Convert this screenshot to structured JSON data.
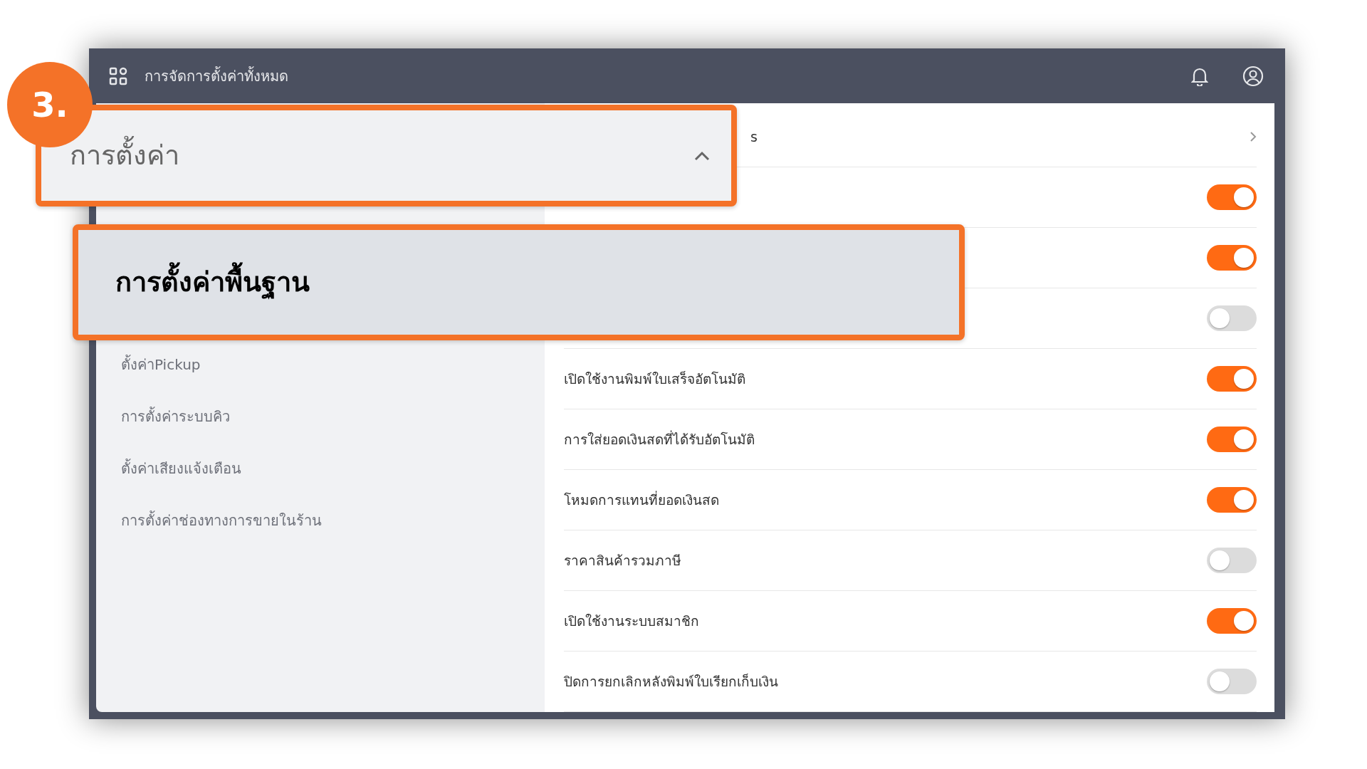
{
  "header": {
    "title": "การจัดการตั้งค่าทั้งหมด"
  },
  "sidebar": {
    "items": [
      {
        "label": "ตั้งค่าPickup"
      },
      {
        "label": "การตั้งค่าระบบคิว"
      },
      {
        "label": "ตั้งค่าเสียงแจ้งเตือน"
      },
      {
        "label": "การตั้งค่าช่องทางการขายในร้าน"
      }
    ]
  },
  "settings": [
    {
      "kind": "link",
      "label": "s"
    },
    {
      "kind": "toggle",
      "on": true
    },
    {
      "kind": "toggle",
      "on": true
    },
    {
      "kind": "toggle",
      "on": false
    },
    {
      "kind": "toggle",
      "label": "เปิดใช้งานพิมพ์ใบเสร็จอัตโนมัติ",
      "on": true
    },
    {
      "kind": "toggle",
      "label": "การใส่ยอดเงินสดที่ได้รับอัตโนมัติ",
      "on": true
    },
    {
      "kind": "toggle",
      "label": "โหมดการแทนที่ยอดเงินสด",
      "on": true
    },
    {
      "kind": "toggle",
      "label": "ราคาสินค้ารวมภาษี",
      "on": false
    },
    {
      "kind": "toggle",
      "label": "เปิดใช้งานระบบสมาชิก",
      "on": true
    },
    {
      "kind": "toggle",
      "label": "ปิดการยกเลิกหลังพิมพ์ใบเรียกเก็บเงิน",
      "on": false
    }
  ],
  "callout": {
    "step": "3.",
    "section": {
      "label": "การตั้งค่า",
      "expanded": true
    },
    "highlight": {
      "label": "การตั้งค่าพื้นฐาน"
    }
  }
}
